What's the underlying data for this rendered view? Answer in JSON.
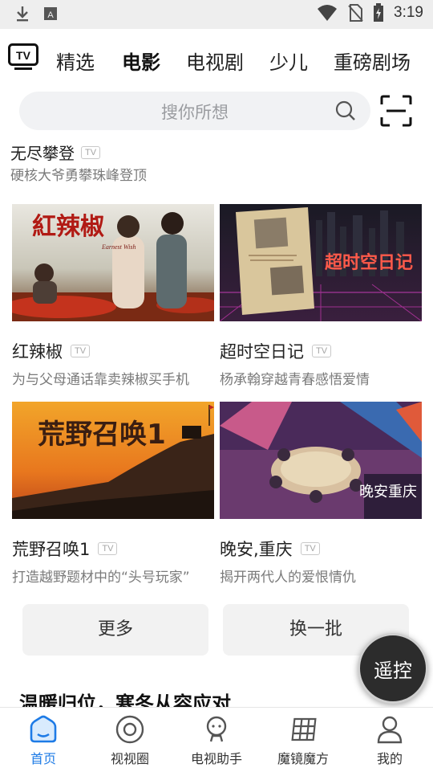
{
  "status_bar": {
    "time": "3:19",
    "icons": [
      "download-icon",
      "a-keyboard-icon",
      "wifi-icon",
      "no-sim-icon",
      "battery-icon"
    ]
  },
  "top_nav": {
    "tabs": [
      {
        "label": "精选",
        "active": false
      },
      {
        "label": "电影",
        "active": true
      },
      {
        "label": "电视剧",
        "active": false
      },
      {
        "label": "少儿",
        "active": false
      },
      {
        "label": "重磅剧场",
        "active": false
      }
    ]
  },
  "search": {
    "placeholder": "搜你所想"
  },
  "previous_item": {
    "title": "无尽攀登",
    "badge": "TV",
    "desc": "硬核大爷勇攀珠峰登顶"
  },
  "cards": [
    {
      "title": "红辣椒",
      "badge": "TV",
      "desc": "为与父母通话靠卖辣椒买手机",
      "poster_text": "紅辣椒",
      "poster_sub": "Earnest Wish"
    },
    {
      "title": "超时空日记",
      "badge": "TV",
      "desc": "杨承翰穿越青春感悟爱情",
      "poster_text": "超时空日记"
    },
    {
      "title": "荒野召唤1",
      "badge": "TV",
      "desc": "打造越野题材中的“头号玩家”",
      "poster_text": "荒野召唤1"
    },
    {
      "title": "晚安,重庆",
      "badge": "TV",
      "desc": "揭开两代人的爱恨情仇",
      "poster_text": "晚安重庆"
    }
  ],
  "actions": {
    "more": "更多",
    "refresh": "换一批"
  },
  "remote": "遥控",
  "section_heading": "温暖归位，寒冬从容应对",
  "bottom_nav": [
    {
      "label": "首页",
      "icon": "home-icon",
      "active": true
    },
    {
      "label": "视视圈",
      "icon": "circle-icon",
      "active": false
    },
    {
      "label": "电视助手",
      "icon": "assistant-icon",
      "active": false
    },
    {
      "label": "魔镜魔方",
      "icon": "grid-cube-icon",
      "active": false
    },
    {
      "label": "我的",
      "icon": "profile-icon",
      "active": false
    }
  ],
  "colors": {
    "accent": "#1e7be6",
    "text": "#222222",
    "muted": "#7a7a7a"
  }
}
